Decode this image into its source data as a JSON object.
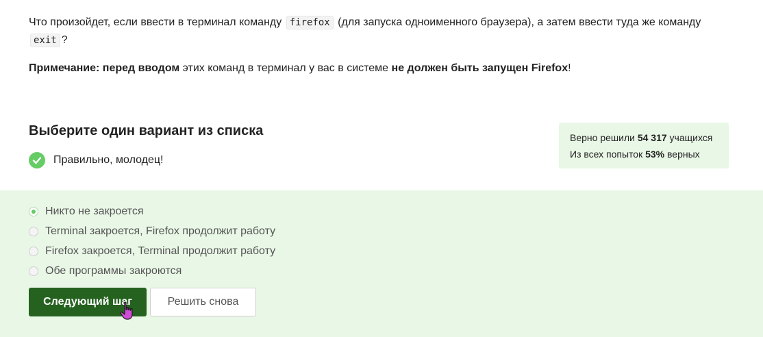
{
  "question": {
    "line1_before": "Что произойдет, если ввести в терминал команду",
    "code1": "firefox",
    "line1_after": "(для запуска одноименного браузера), а затем ввести туда же команду",
    "code2": "exit",
    "line1_end": "?",
    "note_bold": "Примечание: перед вводом",
    "note_mid": "этих команд в терминал у вас в системе",
    "note_bold2": "не должен быть запущен Firefox",
    "note_end": "!"
  },
  "choose_title": "Выберите один вариант из списка",
  "feedback": {
    "text": "Правильно, молодец!",
    "icon": "check-circle-icon"
  },
  "stats": {
    "solved_prefix": "Верно решили",
    "solved_count": "54 317",
    "solved_suffix": "учащихся",
    "attempts_prefix": "Из всех попыток",
    "attempts_percent": "53%",
    "attempts_suffix": "верных"
  },
  "options": [
    {
      "label": "Никто не закроется",
      "selected": true
    },
    {
      "label": "Terminal закроется, Firefox продолжит работу",
      "selected": false
    },
    {
      "label": "Firefox закроется, Terminal продолжит работу",
      "selected": false
    },
    {
      "label": "Обе программы закроются",
      "selected": false
    }
  ],
  "buttons": {
    "next": "Следующий шаг",
    "retry": "Решить снова"
  },
  "colors": {
    "accent_green": "#66cc66",
    "primary_button": "#25621f",
    "answer_background": "#e9f7e6"
  }
}
